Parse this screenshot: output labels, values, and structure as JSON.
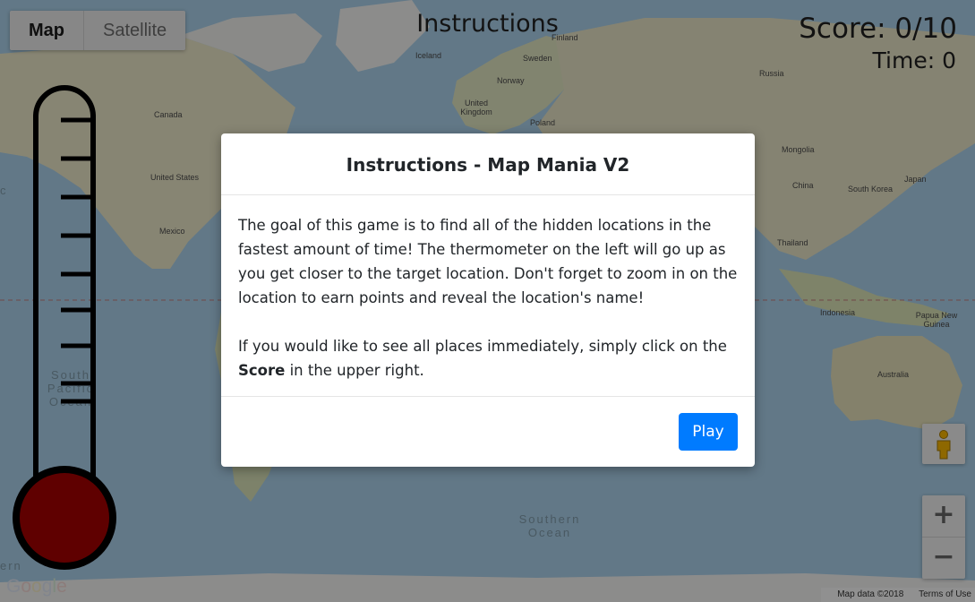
{
  "map_type": {
    "map_label": "Map",
    "satellite_label": "Satellite"
  },
  "header": {
    "title": "Instructions",
    "score_text": "Score: 0/10",
    "time_text": "Time: 0"
  },
  "map_labels": {
    "finland": "Finland",
    "iceland": "Iceland",
    "sweden": "Sweden",
    "norway": "Norway",
    "united_kingdom": "United Kingdom",
    "poland": "Poland",
    "russia": "Russia",
    "canada": "Canada",
    "united_states": "United States",
    "mexico": "Mexico",
    "mongolia": "Mongolia",
    "china": "China",
    "south_korea": "South Korea",
    "japan": "Japan",
    "thailand": "Thailand",
    "indonesia": "Indonesia",
    "papua_new_guinea": "Papua New Guinea",
    "australia": "Australia",
    "south_pacific_ocean": "South Pacific Ocean",
    "southern_ocean": "Southern Ocean",
    "left_edge_fragment": "ern",
    "c_fragment": "c"
  },
  "modal": {
    "title": "Instructions - Map Mania V2",
    "paragraph1": "The goal of this game is to find all of the hidden locations in the fastest amount of time! The thermometer on the left will go up as you get closer to the target location. Don't forget to zoom in on the location to earn points and reveal the location's name!",
    "paragraph2_before": "If you would like to see all places immediately, simply click on the ",
    "paragraph2_bold": "Score",
    "paragraph2_after": " in the upper right.",
    "play_label": "Play"
  },
  "zoom": {
    "in_label": "+",
    "out_label": "−"
  },
  "attribution": {
    "map_data": "Map data ©2018",
    "terms": "Terms of Use",
    "logo": "Google"
  },
  "thermometer": {
    "fill_color": "#a40000",
    "level": 0
  },
  "icons": {
    "pegman": "pegman-icon"
  }
}
